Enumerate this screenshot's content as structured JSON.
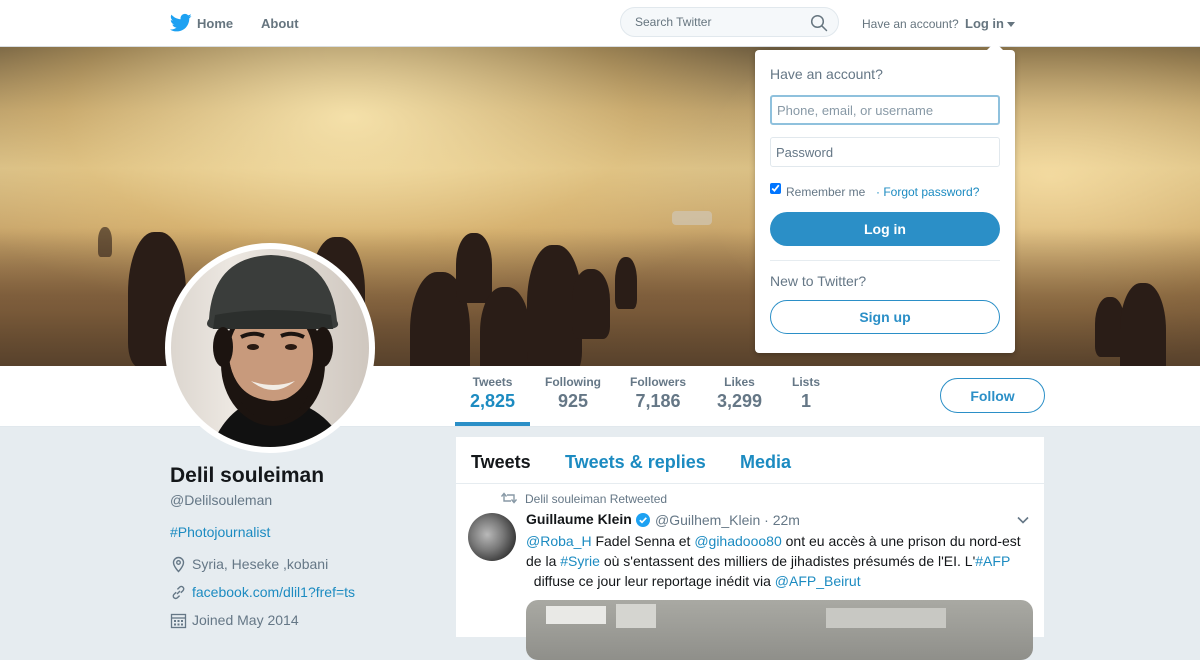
{
  "nav": {
    "home": "Home",
    "about": "About",
    "search_placeholder": "Search Twitter",
    "have_account": "Have an account?",
    "login": "Log in"
  },
  "profile": {
    "name": "Delil souleiman",
    "handle": "@Delilsouleman",
    "bio": "#Photojournalist",
    "location": "Syria, Heseke ,kobani",
    "website": "facebook.com/dlil1?fref=ts",
    "joined": "Joined May 2014"
  },
  "stats": [
    {
      "label": "Tweets",
      "value": "2,825"
    },
    {
      "label": "Following",
      "value": "925"
    },
    {
      "label": "Followers",
      "value": "7,186"
    },
    {
      "label": "Likes",
      "value": "3,299"
    },
    {
      "label": "Lists",
      "value": "1"
    }
  ],
  "follow_label": "Follow",
  "timeline": {
    "tabs": [
      "Tweets",
      "Tweets & replies",
      "Media"
    ],
    "tweet": {
      "retweet_note": "Delil souleiman Retweeted",
      "author": "Guillaume Klein",
      "handle_time": "@Guilhem_Klein · 22m",
      "segments": [
        {
          "t": "@Roba_H",
          "link": true
        },
        {
          "t": " Fadel Senna et ",
          "link": false
        },
        {
          "t": "@gihadooo80",
          "link": true
        },
        {
          "t": " ont eu accès à une prison du nord-est de la ",
          "link": false
        },
        {
          "t": "#Syrie",
          "link": true
        },
        {
          "t": " où s'entassent des milliers de jihadistes présumés de l'EI. L'",
          "link": false
        },
        {
          "t": "#AFP",
          "link": true
        },
        {
          "t": "  diffuse ce jour leur reportage inédit via ",
          "link": false
        },
        {
          "t": "@AFP_Beirut",
          "link": true
        }
      ]
    }
  },
  "login_dropdown": {
    "title": "Have an account?",
    "username_placeholder": "Phone, email, or username",
    "password_placeholder": "Password",
    "remember": "Remember me",
    "forgot": "· Forgot password?",
    "login_button": "Log in",
    "new_to_twitter": "New to Twitter?",
    "signup_button": "Sign up"
  },
  "colors": {
    "accent": "#2b8fc7",
    "link": "#1c8bc1",
    "background": "#e6ecf0"
  }
}
